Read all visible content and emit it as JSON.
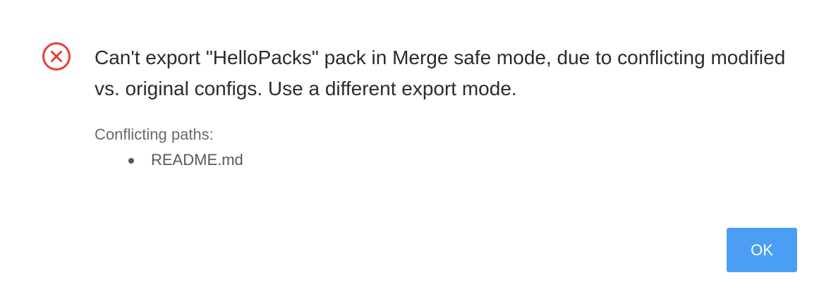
{
  "dialog": {
    "icon": "error-circle-x-icon",
    "message": "Can't export \"HelloPacks\" pack in Merge safe mode, due to conflicting modified vs. original configs. Use a different export mode.",
    "details_heading": "Conflicting paths:",
    "paths": [
      "README.md"
    ],
    "ok_label": "OK"
  },
  "colors": {
    "error": "#e0403a",
    "button": "#4a9ff5",
    "text": "#2b2b2b",
    "muted_text": "#6a6a6a"
  }
}
